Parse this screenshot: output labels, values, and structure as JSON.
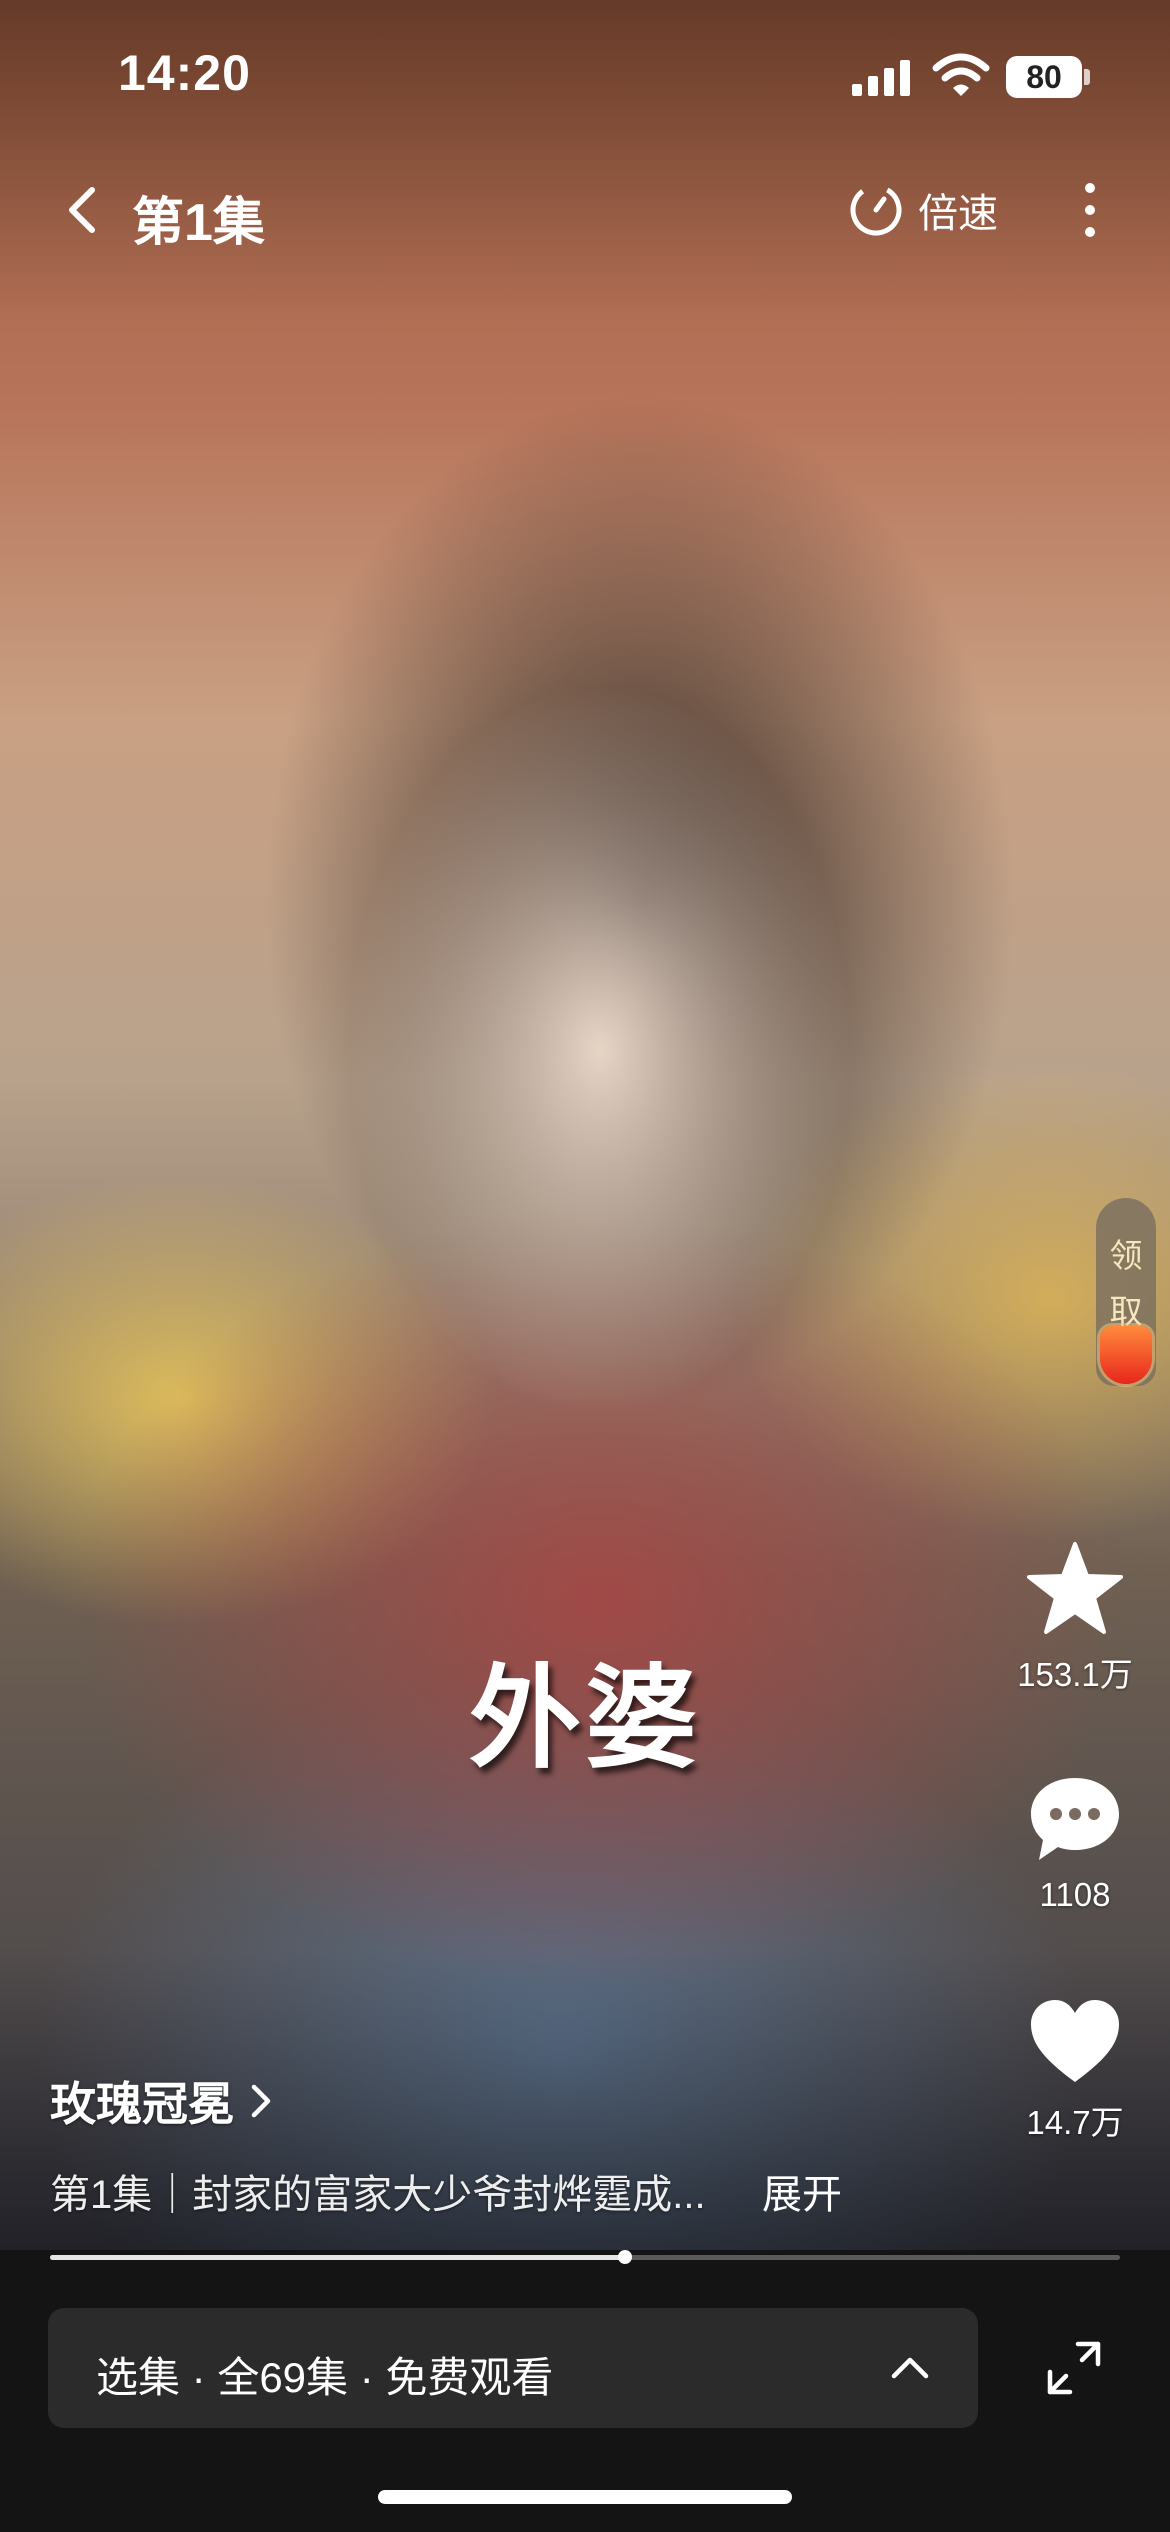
{
  "status_bar": {
    "time": "14:20",
    "battery": "80"
  },
  "nav": {
    "title": "第1集",
    "speed_label": "倍速"
  },
  "reward": {
    "label_line1": "领",
    "label_line2": "取"
  },
  "actions": {
    "favorite_count": "153.1万",
    "comment_count": "1108",
    "like_count": "14.7万"
  },
  "subtitle": "外婆",
  "drama": {
    "title": "玫瑰冠冕",
    "description": "第1集｜封家的富家大少爷封烨霆成...",
    "expand_label": "展开"
  },
  "progress": {
    "fraction": 0.537
  },
  "episode_bar": {
    "label": "选集 · 全69集 · 免费观看"
  },
  "colors": {
    "background": "#141414",
    "bar": "#2b2b2b",
    "reward_red": "#e8261c"
  }
}
